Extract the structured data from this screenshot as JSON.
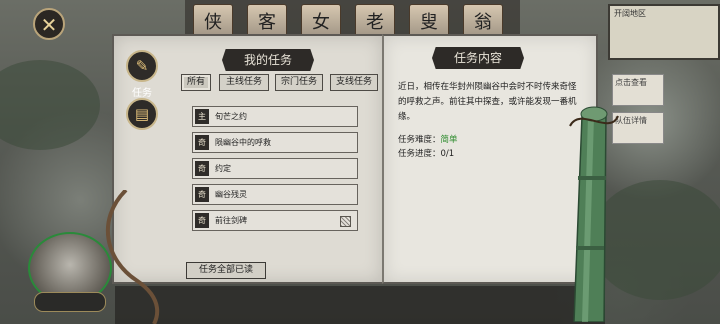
{
  "top": {
    "avatars": [
      "侠",
      "客",
      "女",
      "老",
      "叟",
      "翁"
    ]
  },
  "minimap": {
    "label": "开阔地区"
  },
  "side_notes": [
    "点击查看",
    "队伍详情"
  ],
  "tabs": {
    "task_label": "任务"
  },
  "left_page": {
    "title": "我的任务",
    "filters": [
      {
        "label": "所有",
        "active": true
      },
      {
        "label": "主线任务",
        "active": false
      },
      {
        "label": "宗门任务",
        "active": false
      },
      {
        "label": "支线任务",
        "active": false
      }
    ],
    "quests": [
      {
        "tag": "主",
        "title": "旬芒之约",
        "checked": false
      },
      {
        "tag": "奇",
        "title": "陨幽谷中的呼救",
        "checked": false
      },
      {
        "tag": "奇",
        "title": "约定",
        "checked": false
      },
      {
        "tag": "奇",
        "title": "幽谷残灵",
        "checked": false
      },
      {
        "tag": "奇",
        "title": "前往剑碑",
        "checked": true
      }
    ],
    "read_all": "任务全部已读"
  },
  "right_page": {
    "title": "任务内容",
    "description": "近日，相传在华封州陨幽谷中会时不时传来奇怪的呼救之声。前往其中探查，或许能发现一番机缘。",
    "difficulty_label": "任务难度：",
    "difficulty_value": "简单",
    "progress_label": "任务进度：",
    "progress_value": "0/1"
  },
  "colors": {
    "difficulty_easy": "#2c8b2c",
    "ribbon": "#2d2a27"
  }
}
